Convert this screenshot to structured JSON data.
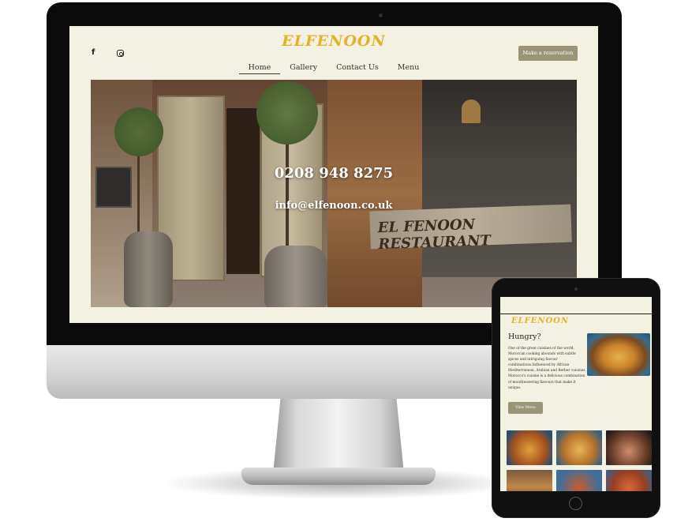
{
  "desktop": {
    "brand": "ELFENOON",
    "social": {
      "facebook_icon": "f",
      "instagram_icon": "instagram-icon"
    },
    "reserve_label": "Make a reservation",
    "nav": [
      {
        "label": "Home",
        "active": true
      },
      {
        "label": "Gallery",
        "active": false
      },
      {
        "label": "Contact Us",
        "active": false
      },
      {
        "label": "Menu",
        "active": false
      }
    ],
    "hero": {
      "phone": "0208 948 8275",
      "email": "info@elfenoon.co.uk",
      "photo_sign": "EL FENOON RESTAURANT"
    }
  },
  "tablet": {
    "brand": "ELFENOON",
    "heading": "Hungry?",
    "intro": "One of the great cuisines of the world, Moroccan cooking abounds with subtle spices and intriguing flavour combinations.Influenced by African Mediterranean, Arabian and Berber cuisines, Morocco's cuisine is a delicious combination of mouthwatering flavours that make it unique.",
    "view_menu_label": "View Menu"
  },
  "colors": {
    "page_bg": "#f3f1e2",
    "brand_gold": "#e2b32a",
    "button_bg": "#9a9478"
  }
}
